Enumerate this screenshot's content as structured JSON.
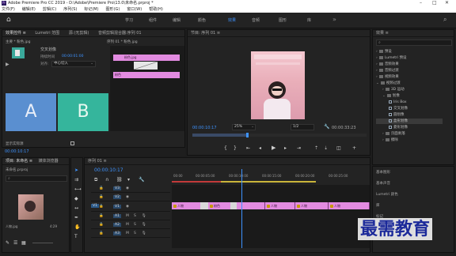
{
  "titlebar": {
    "title": "Adobe Premiere Pro CC 2019 - D:\\Adobe\\Premiere Pro\\13.0\\未命名.prproj *",
    "app_icon": "Pr"
  },
  "menubar": {
    "items": [
      "文件(F)",
      "编辑(E)",
      "剪辑(C)",
      "序列(S)",
      "标记(M)",
      "图形(G)",
      "窗口(W)",
      "帮助(H)"
    ]
  },
  "workspace": {
    "tabs": [
      "学习",
      "组件",
      "编辑",
      "颜色",
      "效果",
      "音频",
      "图形",
      "库"
    ],
    "active_index": 4
  },
  "effect_controls": {
    "tabs": [
      "效果控件 ≡",
      "Lumetri 范围",
      "源:(无剪辑)",
      "音频剪辑混合器:序列 01"
    ],
    "clip_label": "主要 * 粉色.jpg",
    "seq_label": "序列 01 * 粉色.jpg",
    "transition_name": "交叉划像",
    "duration_label": "持续时间",
    "duration_value": "00:00:01:00",
    "alignment_label": "对齐:",
    "alignment_value": "中心切入",
    "letter_a": "A",
    "letter_b": "B",
    "show_actual": "显示实际源",
    "timecode": "00:00:10:17",
    "mini_clip_a": "粉色.jpg",
    "mini_clip_b": "粉色"
  },
  "program_monitor": {
    "title": "节目: 序列 01 ≡",
    "timecode_left": "00:00:10:17",
    "zoom": "25%",
    "quality": "1/2",
    "timecode_right": "00:00:33:23"
  },
  "project_panel": {
    "title": "项目: 未命名 ≡",
    "media_browser": "媒体浏览器",
    "file_name": "未命名.prproj",
    "thumb_label": "人物.jpg",
    "thumb_duration": "4:29"
  },
  "timeline": {
    "title": "序列 01 ≡",
    "timecode": "00:00:10:17",
    "ruler": [
      "00:00",
      "00:00:05:00",
      "00:00:10:00",
      "00:00:15:00",
      "00:00:20:00",
      "00:00:25:00"
    ],
    "tracks_video": [
      "V3",
      "V2",
      "V1"
    ],
    "tracks_audio": [
      "A1",
      "A2",
      "A3"
    ],
    "clips": [
      {
        "label": "人物"
      },
      {
        "label": "粉色"
      },
      {
        "label": "人物"
      },
      {
        "label": "人物"
      },
      {
        "label": "人物"
      }
    ]
  },
  "effects_panel": {
    "title": "效果 ≡",
    "search_placeholder": "",
    "items": [
      {
        "label": "预设",
        "type": "folder",
        "depth": 0
      },
      {
        "label": "Lumetri 预设",
        "type": "folder",
        "depth": 0
      },
      {
        "label": "音频效果",
        "type": "folder",
        "depth": 0
      },
      {
        "label": "音频过渡",
        "type": "folder",
        "depth": 0
      },
      {
        "label": "视频效果",
        "type": "folder",
        "depth": 0
      },
      {
        "label": "视频过渡",
        "type": "folder",
        "depth": 0
      },
      {
        "label": "3D 运动",
        "type": "folder",
        "depth": 1
      },
      {
        "label": "划像",
        "type": "folder",
        "depth": 1
      },
      {
        "label": "Iris Box",
        "type": "fx",
        "depth": 2
      },
      {
        "label": "交叉划像",
        "type": "fx",
        "depth": 2
      },
      {
        "label": "圆划像",
        "type": "fx",
        "depth": 2
      },
      {
        "label": "盒形划像",
        "type": "fx",
        "depth": 2
      },
      {
        "label": "菱形划像",
        "type": "fx",
        "depth": 2
      },
      {
        "label": "页面剥落",
        "type": "folder",
        "depth": 1
      },
      {
        "label": "擦除",
        "type": "folder",
        "depth": 1
      }
    ],
    "sub_panels": [
      "基本图形",
      "基本声音",
      "Lumetri 颜色",
      "库",
      "标记"
    ]
  },
  "watermark": "最需教育",
  "colors": {
    "accent": "#3e93ff",
    "clip": "#e28be0",
    "timecode": "#3e93ff"
  }
}
